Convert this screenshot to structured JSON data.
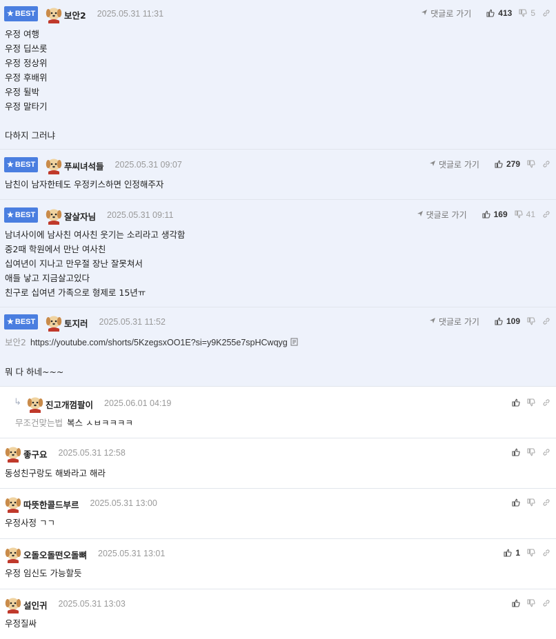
{
  "labels": {
    "best": "BEST",
    "goto_reply": "댓글로 가기"
  },
  "colors": {
    "best_badge": "#4a7ee0",
    "best_bg": "#eef2fb",
    "meta_gray": "#999999"
  },
  "comments": [
    {
      "best": true,
      "nick": "보안2",
      "date": "2025.05.31 11:31",
      "likes": "413",
      "dislikes": "5",
      "lines": [
        "우정 여행",
        "우정 딥쓰롯",
        "우정 정상위",
        "우정 후배위",
        "우정 뒬박",
        "우정 말타기",
        "",
        "다하지 그러냐"
      ]
    },
    {
      "best": true,
      "nick": "푸씨녀석들",
      "date": "2025.05.31 09:07",
      "likes": "279",
      "dislikes": "",
      "lines": [
        "남친이 남자한테도 우정키스하면 인정해주자"
      ]
    },
    {
      "best": true,
      "nick": "잘살자님",
      "date": "2025.05.31 09:11",
      "likes": "169",
      "dislikes": "41",
      "lines": [
        "남녀사이에 남사친 여사친 웃기는 소리라고 생각함",
        "중2때 학원에서 만난 여사친",
        "십여년이 지나고 만우절 장난 잘못쳐서",
        "애들 낳고 지금살고있다",
        "친구로 십여년 가족으로 형제로 15년ㅠ"
      ]
    },
    {
      "best": true,
      "nick": "토지러",
      "date": "2025.05.31 11:52",
      "likes": "109",
      "dislikes": "",
      "mention": "보안2",
      "url": "https://youtube.com/shorts/5KzegsxOO1E?si=y9K255e7spHCwqyg",
      "lines": [
        "",
        "",
        "뭐 다 하네~~~"
      ]
    },
    {
      "best": false,
      "reply": true,
      "nick": "진고개껌팔이",
      "date": "2025.06.01 04:19",
      "likes": "",
      "dislikes": "",
      "mention": "무조건맞는법",
      "lines": [
        "복스 ㅅㅂㅋㅋㅋㅋ"
      ]
    },
    {
      "best": false,
      "nick": "좋구요",
      "date": "2025.05.31 12:58",
      "likes": "",
      "dislikes": "",
      "lines": [
        "동성친구랑도 해봐라고 해라"
      ]
    },
    {
      "best": false,
      "nick": "따뜻한콜드부르",
      "date": "2025.05.31 13:00",
      "likes": "",
      "dislikes": "",
      "lines": [
        "우정사정 ㄱㄱ"
      ]
    },
    {
      "best": false,
      "nick": "오돌오돌떤오돌뼈",
      "date": "2025.05.31 13:01",
      "likes": "1",
      "dislikes": "",
      "lines": [
        "우정 임신도 가능할듯"
      ]
    },
    {
      "best": false,
      "nick": "설인귀",
      "date": "2025.05.31 13:03",
      "likes": "",
      "dislikes": "",
      "lines": [
        "우정질싸"
      ]
    }
  ]
}
